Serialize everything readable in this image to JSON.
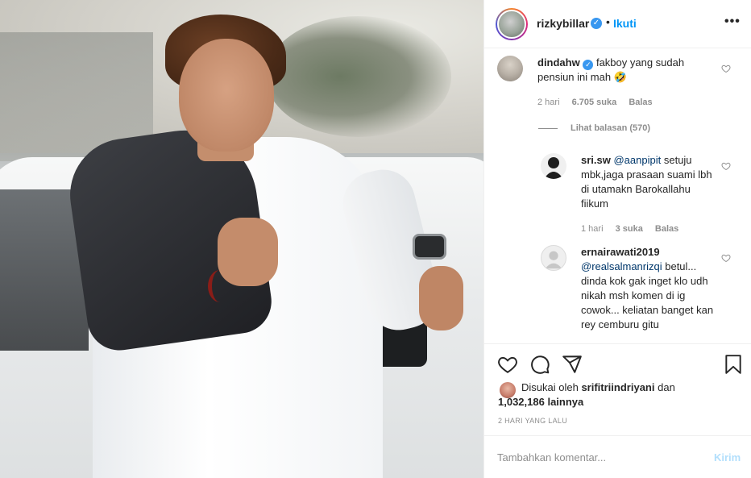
{
  "post": {
    "author": {
      "username": "rizkybillar",
      "follow_label": "Ikuti",
      "separator": "•",
      "more_label": "•••"
    },
    "comments": [
      {
        "username": "dindahw",
        "verified": true,
        "text": "fakboy yang sudah pensiun ini mah 🤣",
        "time": "2 hari",
        "likes": "6.705 suka",
        "reply_label": "Balas",
        "view_replies": "Lihat balasan (570)"
      },
      {
        "username": "sri.sw",
        "mention": "@aanpipit",
        "text": " setuju mbk,jaga prasaan suami lbh di utamakn Barokallahu fiikum",
        "time": "1 hari",
        "likes": "3 suka",
        "reply_label": "Balas"
      },
      {
        "username": "ernairawati2019",
        "mention": "@realsalmanrizqi",
        "text": " betul... dinda kok gak inget klo udh nikah msh komen di ig cowok... keliatan banget kan rey cemburu gitu"
      }
    ],
    "likes": {
      "prefix": "Disukai oleh",
      "top_liker": "srifitriindriyani",
      "conjunction": "dan",
      "others_count": "1,032,186",
      "others_label": "lainnya"
    },
    "timestamp": "2 HARI YANG LALU",
    "add_comment": {
      "placeholder": "Tambahkan komentar...",
      "post_label": "Kirim"
    },
    "icons": [
      "heart-icon",
      "comment-icon",
      "share-icon",
      "bookmark-icon",
      "verified-icon",
      "more-icon"
    ],
    "colors": {
      "link": "#0095f6",
      "verified": "#3897f0",
      "muted": "#8e8e8e",
      "post_disabled": "#b2dffc"
    }
  }
}
